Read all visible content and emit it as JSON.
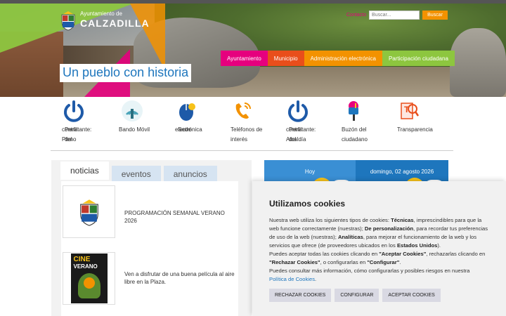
{
  "header": {
    "org_small": "Ayuntamiento de",
    "org_name": "CALZADILLA",
    "slogan": "Un pueblo con historia",
    "search": {
      "label": "Contacto",
      "placeholder": "Buscar...",
      "button": "Buscar"
    },
    "nav": [
      {
        "label": "Ayuntamiento",
        "color": "#e6007e"
      },
      {
        "label": "Municipio",
        "color": "#e94e1b"
      },
      {
        "label": "Administración electrónica",
        "color": "#f39200"
      },
      {
        "label": "Participación ciudadana",
        "color": "#8dc63f"
      }
    ]
  },
  "quick_links": [
    {
      "lines": [
        "Perfil",
        "del"
      ],
      "below": [
        "contratante:",
        "Pleno"
      ],
      "icon": "power-icon"
    },
    {
      "lines": [],
      "below": [
        "Bando Móvil"
      ],
      "icon": "broadcast-icon"
    },
    {
      "lines": [
        "Sede"
      ],
      "below": [
        "electrónica"
      ],
      "icon": "mouse-hand-icon"
    },
    {
      "lines": [],
      "below": [
        "Teléfonos de",
        "interés"
      ],
      "icon": "phone-icon"
    },
    {
      "lines": [
        "Perfil",
        "del"
      ],
      "below": [
        "contratante:",
        "Alcaldía"
      ],
      "icon": "power-icon"
    },
    {
      "lines": [],
      "below": [
        "Buzón del",
        "ciudadano"
      ],
      "icon": "mailbox-icon"
    },
    {
      "lines": [],
      "below": [
        "Transparencia"
      ],
      "icon": "magnifier-document-icon"
    }
  ],
  "news": {
    "tabs": [
      "noticias",
      "eventos",
      "anuncios"
    ],
    "items": [
      {
        "title": "PROGRAMACIÓN SEMANAL VERANO 2026",
        "thumb": "coat-of-arms-icon"
      },
      {
        "title": "Ven a disfrutar de una buena película al aire libre en la Plaza.",
        "thumb": "cine-de-verano-poster",
        "poster_text": [
          "CINE",
          "VERANO"
        ]
      }
    ]
  },
  "calendar": {
    "today_label": "Hoy",
    "date_label": "domingo, 02 agosto 2026"
  },
  "cookies": {
    "title": "Utilizamos cookies",
    "p1_a": "Nuestra web utiliza los siguientes tipos de cookies: ",
    "p1_b": "Técnicas",
    "p1_c": ", imprescindibles para que la web funcione correctamente (nuestras); ",
    "p1_d": "De personalización",
    "p1_e": ", para recordar tus preferencias de uso de la web (nuestras); ",
    "p1_f": "Analíticas",
    "p1_g": ", para mejorar el funcionamiento de la web y los servicios que ofrece (de proveedores ubicados en los ",
    "p1_h": "Estados Unidos",
    "p1_i": ").",
    "p2_a": "Puedes aceptar todas las cookies clicando en ",
    "p2_b": "\"Aceptar Cookies\"",
    "p2_c": ", rechazarlas clicando en ",
    "p2_d": "\"Rechazar Cookies\"",
    "p2_e": ", o configurarlas en ",
    "p2_f": "\"Configurar\"",
    "p2_g": ".",
    "p3": "Puedes consultar más información, cómo configurarlas y posibles riesgos en nuestra",
    "link": "Política de Cookies",
    "link_end": ".",
    "buttons": {
      "reject": "RECHAZAR COOKIES",
      "configure": "CONFIGURAR",
      "accept": "ACEPTAR COOKIES"
    }
  }
}
